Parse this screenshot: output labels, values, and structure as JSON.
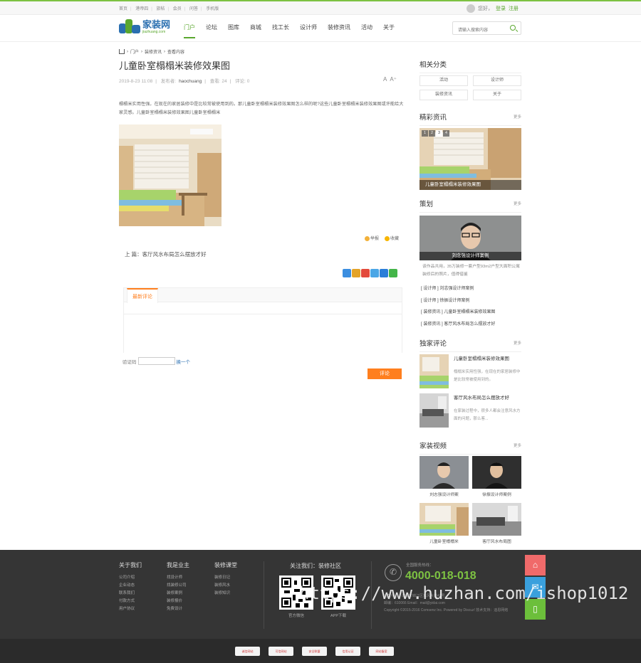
{
  "topbar": {
    "links": [
      "首页",
      "港帝四",
      "旅帖",
      "会员",
      "问答",
      "手机版"
    ],
    "greeting": "您好，",
    "login": "登录",
    "register": "注册"
  },
  "logo": {
    "cn": "家装网",
    "en": "jiazhuang.com"
  },
  "nav": [
    "门户",
    "论坛",
    "图库",
    "商城",
    "找工长",
    "设计师",
    "装修资讯",
    "活动",
    "关于"
  ],
  "search": {
    "placeholder": "请输入搜索内容"
  },
  "breadcrumb": [
    "门户",
    "装修资讯",
    "查看内容"
  ],
  "article": {
    "title": "儿童卧室榻榻米装修效果图",
    "date": "2019-8-23 11:08",
    "author_label": "发布者:",
    "author": "haochuang",
    "views": "查看: 24",
    "comments": "评论: 0",
    "font_small": "A",
    "font_large": "A⁺",
    "body": "榻榻米实用性强，在现在的家居装修中是比较常被使用到的。那儿童卧室榻榻米装修效果图怎么样的呢?这些儿童卧室榻榻米装修效果图或许能给大家灵感。儿童卧室榻榻米装修效果图儿童卧室榻榻米",
    "report": "举报",
    "favorite": "收藏",
    "prev_label": "上  篇：",
    "prev_title": "客厅风水布局怎么摆放才好"
  },
  "comment": {
    "tab": "最新评论",
    "verify_label": "验证码",
    "verify_hint": "换一个",
    "submit": "评论"
  },
  "sidebar": {
    "categories_title": "相关分类",
    "categories": [
      "活动",
      "设计师",
      "装修资讯",
      "关于"
    ],
    "news_title": "精彩资讯",
    "more": "更多",
    "slide_numbers": [
      "1",
      "2",
      "3",
      "4"
    ],
    "slide_caption": "儿童卧室榻榻米装修效果图",
    "plan_title": "策划",
    "plan_caption": "刘念强设计师案例",
    "plan_desc": "该作品共用，35万装修一套户型93m2户型大面积公寓装修后的照片，值得借鉴",
    "plan_list": [
      "[ 设计师 ] 刘志强设计师案例",
      "[ 设计师 ] 徐振设计师案例",
      "[ 装修资讯 ] 儿童卧室榻榻米装修效果图",
      "[ 装修资讯 ] 客厅风水布局怎么摆放才好"
    ],
    "hot_title": "独家评论",
    "hot_items": [
      {
        "title": "儿童卧室榻榻米装修效果图",
        "desc": "榻榻米实用性强，在现在的家居装修中是比较常被使用到的。"
      },
      {
        "title": "客厅风水布局怎么摆放才好",
        "desc": "在家装过程中，很多人都会注意风水方面的问题，那么客..."
      }
    ],
    "video_title": "家装视频",
    "videos": [
      "刘志强设计师案",
      "徐振设计师案例",
      "儿童卧室榻榻米",
      "客厅风水布局图"
    ]
  },
  "footer": {
    "cols": [
      {
        "title": "关于我们",
        "items": [
          "公司介绍",
          "企业动态",
          "联系我们",
          "付款方式",
          "用户协议"
        ]
      },
      {
        "title": "我是业主",
        "items": [
          "找设计师",
          "找装修公司",
          "装修案例",
          "装修报价",
          "免费设计"
        ]
      },
      {
        "title": "装修课堂",
        "items": [
          "装修日记",
          "装修风水",
          "装修知识"
        ]
      }
    ],
    "qr_title": "关注我们：装修社区",
    "qr_labels": [
      "官方微信",
      "APP下载"
    ],
    "hotline_label": "全国服务热线：",
    "hotline": "4000-018-018",
    "info": [
      "运营中心：成都市锦江区东风大道42号",
      "邮编：610066 Email：mail@yidai.com",
      "Copyright ©2015-2016 Comsenz Inc. Powered by Discuz! 技术支持：迪恩网络"
    ],
    "watermark": "https://www.huzhan.com/ishop1012",
    "badges": [
      "诚信网站",
      "可信网站",
      "安全联盟",
      "信用认证",
      "网站备案"
    ]
  }
}
